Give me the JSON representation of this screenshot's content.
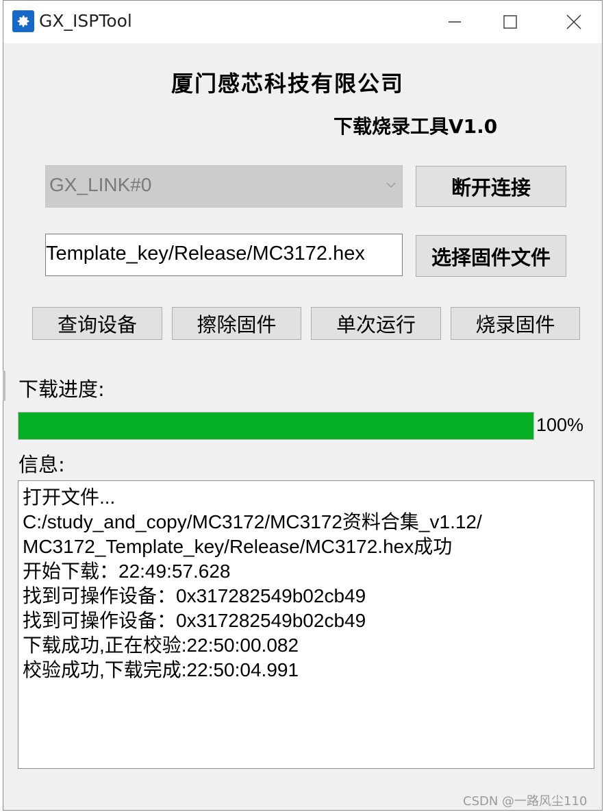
{
  "titlebar": {
    "title": "GX_ISPTool",
    "icon": "gear-icon",
    "controls": [
      "minimize-icon",
      "maximize-icon",
      "close-icon"
    ]
  },
  "header": {
    "company": "厦门感芯科技有限公司",
    "tool_title": "下载烧录工具V1.0"
  },
  "device": {
    "selected": "GX_LINK#0",
    "disconnect_label": "断开连接"
  },
  "firmware": {
    "path": "Template_key/Release/MC3172.hex",
    "select_label": "选择固件文件"
  },
  "actions": {
    "query": "查询设备",
    "erase": "擦除固件",
    "run_once": "单次运行",
    "flash": "烧录固件"
  },
  "progress": {
    "label": "下载进度:",
    "value": 1.0,
    "text": "100%",
    "color": "#06b025"
  },
  "log": {
    "label": "信息:",
    "lines": [
      "打开文件...",
      "C:/study_and_copy/MC3172/MC3172资料合集_v1.12/",
      "MC3172_Template_key/Release/MC3172.hex成功",
      "开始下载：22:49:57.628",
      "找到可操作设备：0x317282549b02cb49",
      "找到可操作设备：0x317282549b02cb49",
      "下载成功,正在校验:22:50:00.082",
      "校验成功,下载完成:22:50:04.991"
    ]
  },
  "watermark": "CSDN @一路风尘110"
}
